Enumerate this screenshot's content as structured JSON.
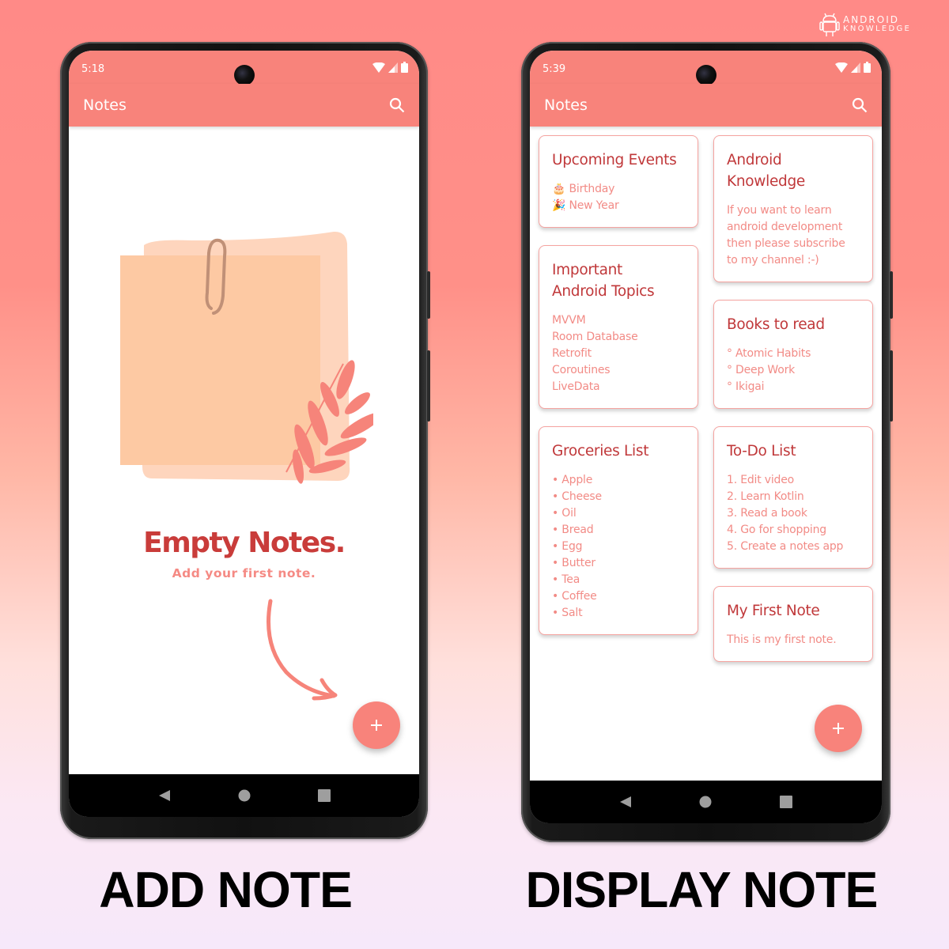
{
  "brand": {
    "line1": "ANDROID",
    "line2": "KNOWLEDGE",
    "icon": "android-robot-icon"
  },
  "colors": {
    "accent": "#f8837b",
    "title_text": "#c0383a",
    "body_text": "#f28b86",
    "card_border": "#f5a3a0"
  },
  "left_phone": {
    "status": {
      "time": "5:18",
      "icons": [
        "wifi-icon",
        "signal-icon",
        "battery-icon"
      ]
    },
    "app_bar": {
      "title": "Notes",
      "search_icon": "search-icon"
    },
    "empty_state": {
      "title": "Empty Notes.",
      "subtitle": "Add your first note."
    },
    "fab": {
      "label": "+",
      "icon": "add-icon"
    },
    "nav": [
      "back-icon",
      "home-icon",
      "recents-icon"
    ],
    "caption": "ADD NOTE"
  },
  "right_phone": {
    "status": {
      "time": "5:39",
      "icons": [
        "wifi-icon",
        "signal-icon",
        "battery-icon"
      ]
    },
    "app_bar": {
      "title": "Notes",
      "search_icon": "search-icon"
    },
    "notes": [
      {
        "title": "Upcoming Events",
        "lines": [
          "🎂 Birthday",
          "🎉 New Year"
        ]
      },
      {
        "title": "Android Knowledge",
        "lines": [
          "If you want to learn",
          "android development",
          "then please subscribe",
          "to my channel :-)"
        ]
      },
      {
        "title": "Important Android Topics",
        "lines": [
          "MVVM",
          "Room Database",
          "Retrofit",
          "Coroutines",
          "LiveData"
        ]
      },
      {
        "title": "Books to read",
        "lines": [
          "° Atomic Habits",
          "° Deep Work",
          "° Ikigai"
        ]
      },
      {
        "title": "Groceries List",
        "lines": [
          "• Apple",
          "• Cheese",
          "• Oil",
          "• Bread",
          "• Egg",
          "• Butter",
          "• Tea",
          "• Coffee",
          "• Salt"
        ]
      },
      {
        "title": "To-Do List",
        "lines": [
          "1. Edit video",
          "2. Learn Kotlin",
          "3. Read a book",
          "4. Go for shopping",
          "5. Create a notes app"
        ]
      },
      {
        "title": "My First Note",
        "lines": [
          "This is my first note."
        ]
      }
    ],
    "fab": {
      "label": "+",
      "icon": "add-icon"
    },
    "nav": [
      "back-icon",
      "home-icon",
      "recents-icon"
    ],
    "caption": "DISPLAY NOTE"
  }
}
